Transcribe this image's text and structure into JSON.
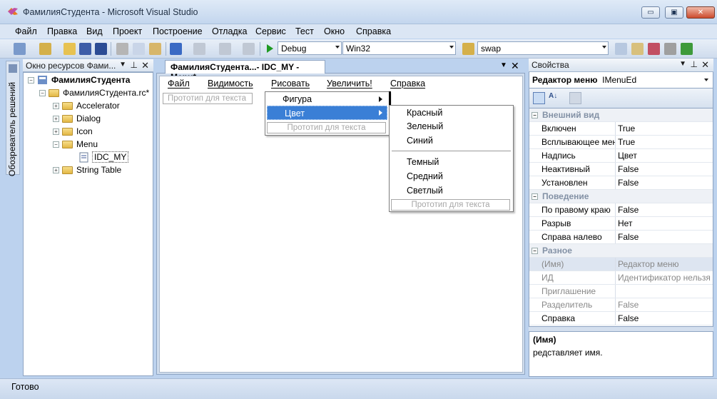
{
  "window": {
    "title": "ФамилияСтудента - Microsoft Visual Studio",
    "min_glyph": "▭",
    "max_glyph": "▣",
    "close_glyph": "✕"
  },
  "menubar": [
    "Файл",
    "Правка",
    "Вид",
    "Проект",
    "Построение",
    "Отладка",
    "Сервис",
    "Тест",
    "Окно",
    "Справка"
  ],
  "toolbar": {
    "config": "Debug",
    "platform": "Win32",
    "find": "swap"
  },
  "solution_tab": "Обозреватель решений",
  "resource_view": {
    "title": "Окно ресурсов Фами...",
    "pin_glyph": "⊥",
    "tree": {
      "root": "ФамилияСтудента",
      "rc": "ФамилияСтудента.rc*",
      "items": [
        "Accelerator",
        "Dialog",
        "Icon",
        "Menu"
      ],
      "menu_child": "IDC_MY",
      "last": "String Table"
    }
  },
  "editor": {
    "tab": "ФамилияСтудента...- IDC_MY - Menu*",
    "menu": [
      "Файл",
      "Видимость",
      "Рисовать",
      "Увеличить!",
      "Справка"
    ],
    "prototype": "Прототип для текста",
    "dropdown": [
      "Фигура",
      "Цвет"
    ],
    "color_submenu": [
      "Красный",
      "Зеленый",
      "Синий",
      "Темный",
      "Средний",
      "Светлый"
    ]
  },
  "properties": {
    "title": "Свойства",
    "object_name": "Редактор меню",
    "object_type": "IMenuEd",
    "categories": [
      {
        "name": "Внешний вид",
        "rows": [
          {
            "name": "Включен",
            "value": "True"
          },
          {
            "name": "Всплывающее меню",
            "value": "True"
          },
          {
            "name": "Надпись",
            "value": "Цвет"
          },
          {
            "name": "Неактивный",
            "value": "False"
          },
          {
            "name": "Установлен",
            "value": "False"
          }
        ]
      },
      {
        "name": "Поведение",
        "rows": [
          {
            "name": "По правому краю",
            "value": "False"
          },
          {
            "name": "Разрыв",
            "value": "Нет"
          },
          {
            "name": "Справа налево",
            "value": "False"
          }
        ]
      },
      {
        "name": "Разное",
        "rows": [
          {
            "name": "(Имя)",
            "value": "Редактор меню"
          },
          {
            "name": "ИД",
            "value": "Идентификатор нельзя"
          },
          {
            "name": "Приглашение",
            "value": ""
          },
          {
            "name": "Разделитель",
            "value": "False"
          },
          {
            "name": "Справка",
            "value": "False"
          }
        ]
      }
    ],
    "desc_title": "(Имя)",
    "desc_text": "редставляет имя."
  },
  "status": "Готово"
}
